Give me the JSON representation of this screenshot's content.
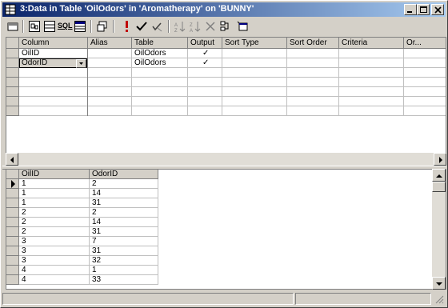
{
  "window": {
    "title": "3:Data in Table 'OilOdors' in 'Aromatherapy' on 'BUNNY'"
  },
  "toolbar": {
    "buttons": [
      "table-icon",
      "diagram-pane-icon",
      "grid-pane-icon",
      "sql-pane-icon",
      "results-pane-icon",
      "query-type-icon",
      "run-icon",
      "verify-sql-icon",
      "check-icon",
      "sort-asc-icon",
      "sort-desc-icon",
      "remove-filter-icon",
      "group-by-icon",
      "add-table-icon"
    ],
    "sql_label": "SQL"
  },
  "criteria_grid": {
    "columns": [
      "Column",
      "Alias",
      "Table",
      "Output",
      "Sort Type",
      "Sort Order",
      "Criteria",
      "Or..."
    ],
    "rows": [
      {
        "column": "OilID",
        "alias": "",
        "table": "OilOdors",
        "output": "✓"
      },
      {
        "column": "OdorID",
        "alias": "",
        "table": "OilOdors",
        "output": "✓"
      }
    ]
  },
  "results_grid": {
    "columns": [
      "OilID",
      "OdorID"
    ],
    "rows": [
      [
        "1",
        "2"
      ],
      [
        "1",
        "14"
      ],
      [
        "1",
        "31"
      ],
      [
        "2",
        "2"
      ],
      [
        "2",
        "14"
      ],
      [
        "2",
        "31"
      ],
      [
        "3",
        "7"
      ],
      [
        "3",
        "31"
      ],
      [
        "3",
        "32"
      ],
      [
        "4",
        "1"
      ],
      [
        "4",
        "33"
      ]
    ]
  },
  "colors": {
    "title_active": "#0a246a",
    "face": "#d4d0c8"
  }
}
